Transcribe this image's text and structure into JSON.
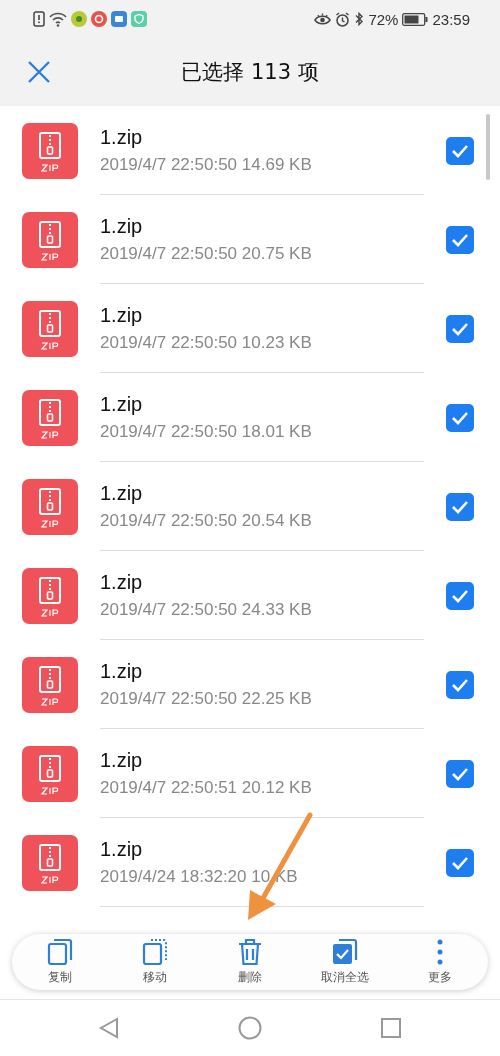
{
  "status_bar": {
    "battery": "72%",
    "time": "23:59"
  },
  "header": {
    "title": "已选择 113 项"
  },
  "files": [
    {
      "name": "1.zip",
      "meta": "2019/4/7 22:50:50 14.69 KB",
      "checked": true
    },
    {
      "name": "1.zip",
      "meta": "2019/4/7 22:50:50 20.75 KB",
      "checked": true
    },
    {
      "name": "1.zip",
      "meta": "2019/4/7 22:50:50 10.23 KB",
      "checked": true
    },
    {
      "name": "1.zip",
      "meta": "2019/4/7 22:50:50 18.01 KB",
      "checked": true
    },
    {
      "name": "1.zip",
      "meta": "2019/4/7 22:50:50 20.54 KB",
      "checked": true
    },
    {
      "name": "1.zip",
      "meta": "2019/4/7 22:50:50 24.33 KB",
      "checked": true
    },
    {
      "name": "1.zip",
      "meta": "2019/4/7 22:50:50 22.25 KB",
      "checked": true
    },
    {
      "name": "1.zip",
      "meta": "2019/4/7 22:50:51 20.12 KB",
      "checked": true
    },
    {
      "name": "1.zip",
      "meta": "2019/4/24 18:32:20 10 KB",
      "checked": true
    }
  ],
  "toolbar": [
    {
      "kind": "copy",
      "label": "复制"
    },
    {
      "kind": "move",
      "label": "移动"
    },
    {
      "kind": "delete",
      "label": "删除"
    },
    {
      "kind": "deselect",
      "label": "取消全选"
    },
    {
      "kind": "more",
      "label": "更多"
    }
  ]
}
